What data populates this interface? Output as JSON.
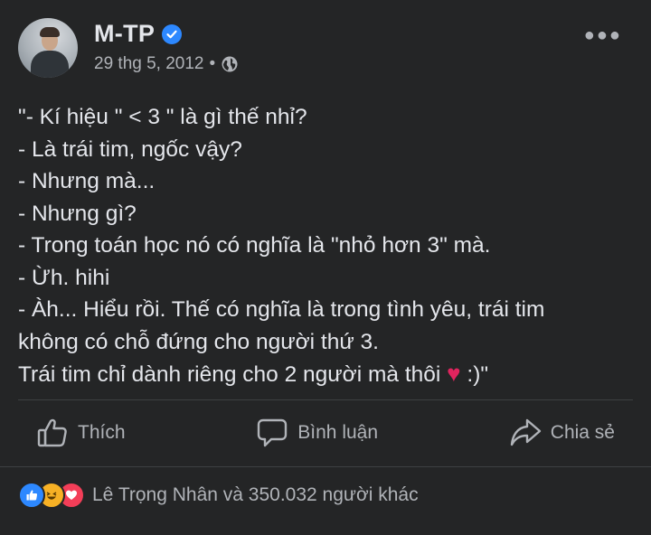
{
  "post": {
    "author": "M-TP",
    "date": "29 thg 5, 2012",
    "separator": "•",
    "text_lines": [
      "\"- Kí hiệu \" < 3 \" là gì thế nhỉ?",
      "- Là trái tim, ngốc vậy?",
      "- Nhưng mà...",
      "- Nhưng gì?",
      "- Trong toán học nó có nghĩa là \"nhỏ hơn 3\" mà.",
      "- Ừh. hihi",
      "- Àh... Hiểu rồi. Thế có nghĩa là trong tình yêu, trái tim",
      "không có chỗ đứng cho người thứ 3.",
      "Trái tim chỉ dành riêng cho 2 người mà thôi"
    ],
    "heart_symbol": "♥",
    "text_end": " :)\""
  },
  "actions": {
    "like_label": "Thích",
    "comment_label": "Bình luận",
    "share_label": "Chia sẻ"
  },
  "reactions": {
    "icons": [
      "like-icon",
      "haha-icon",
      "love-icon"
    ],
    "summary": "Lê Trọng Nhân và 350.032 người khác"
  },
  "colors": {
    "background": "#242526",
    "text": "#e4e6eb",
    "secondary_text": "#b0b3b8",
    "verified_blue": "#2d88ff",
    "heart_red": "#e0245e"
  }
}
